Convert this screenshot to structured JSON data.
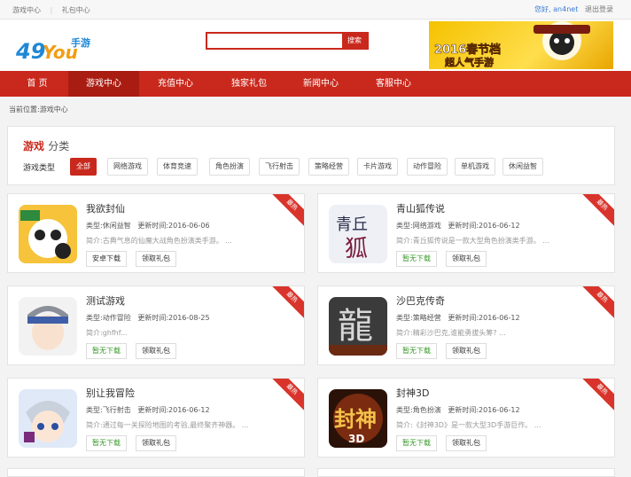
{
  "topbar": {
    "links": [
      "游戏中心",
      "礼包中心"
    ],
    "greeting": "您好,",
    "username": "an4net",
    "logout": "退出登录"
  },
  "logo": {
    "text_main": "49You",
    "text_sub": "手游"
  },
  "search": {
    "value": "",
    "button": "搜索"
  },
  "banner": {
    "line1": "2016春节档",
    "line2": "超人气手游"
  },
  "nav": {
    "items": [
      "首 页",
      "游戏中心",
      "充值中心",
      "独家礼包",
      "新闻中心",
      "客服中心"
    ],
    "active_index": 1
  },
  "breadcrumb": "当前位置:游戏中心",
  "category": {
    "title_red": "游戏",
    "title_gray": "分类",
    "label": "游戏类型",
    "tags": [
      "全部",
      "网络游戏",
      "体育竞速",
      "角色扮演",
      "飞行射击",
      "策略经营",
      "卡片游戏",
      "动作冒险",
      "单机游戏",
      "休闲益智"
    ],
    "active_index": 0
  },
  "games": [
    {
      "name": "我欲封仙",
      "type": "类型:休闲益智",
      "updated": "更新时间:2016-06-06",
      "desc": "简介:古典气息的仙魔大战角色扮演类手游。 ...",
      "download": "安卓下载",
      "gift": "领取礼包",
      "ribbon": "最热"
    },
    {
      "name": "青山狐传说",
      "type": "类型:网络游戏",
      "updated": "更新时间:2016-06-12",
      "desc": "简介:青丘狐传说是一款大型角色扮演类手游。 ...",
      "download": "暂无下载",
      "gift": "领取礼包",
      "ribbon": "最热"
    },
    {
      "name": "测试游戏",
      "type": "类型:动作冒险",
      "updated": "更新时间:2016-08-25",
      "desc": "简介:ghfhf...",
      "download": "暂无下载",
      "gift": "领取礼包",
      "ribbon": "最热"
    },
    {
      "name": "沙巴克传奇",
      "type": "类型:策略经营",
      "updated": "更新时间:2016-06-12",
      "desc": "简介:精彩沙巴克,谁能勇拔头筹? ...",
      "download": "暂无下载",
      "gift": "领取礼包",
      "ribbon": "最热"
    },
    {
      "name": "别让我冒险",
      "type": "类型:飞行射击",
      "updated": "更新时间:2016-06-12",
      "desc": "简介:通过每一关探险地图的考验,最终聚齐神器。 ...",
      "download": "暂无下载",
      "gift": "领取礼包",
      "ribbon": "最热"
    },
    {
      "name": "封神3D",
      "type": "类型:角色扮演",
      "updated": "更新时间:2016-06-12",
      "desc": "简介:《封神3D》是一款大型3D手游巨作。 ...",
      "download": "暂无下载",
      "gift": "领取礼包",
      "ribbon": "最热"
    }
  ],
  "colors": {
    "brand": "#c9281c",
    "green": "#3a9a2b",
    "link": "#3a7bd5"
  }
}
